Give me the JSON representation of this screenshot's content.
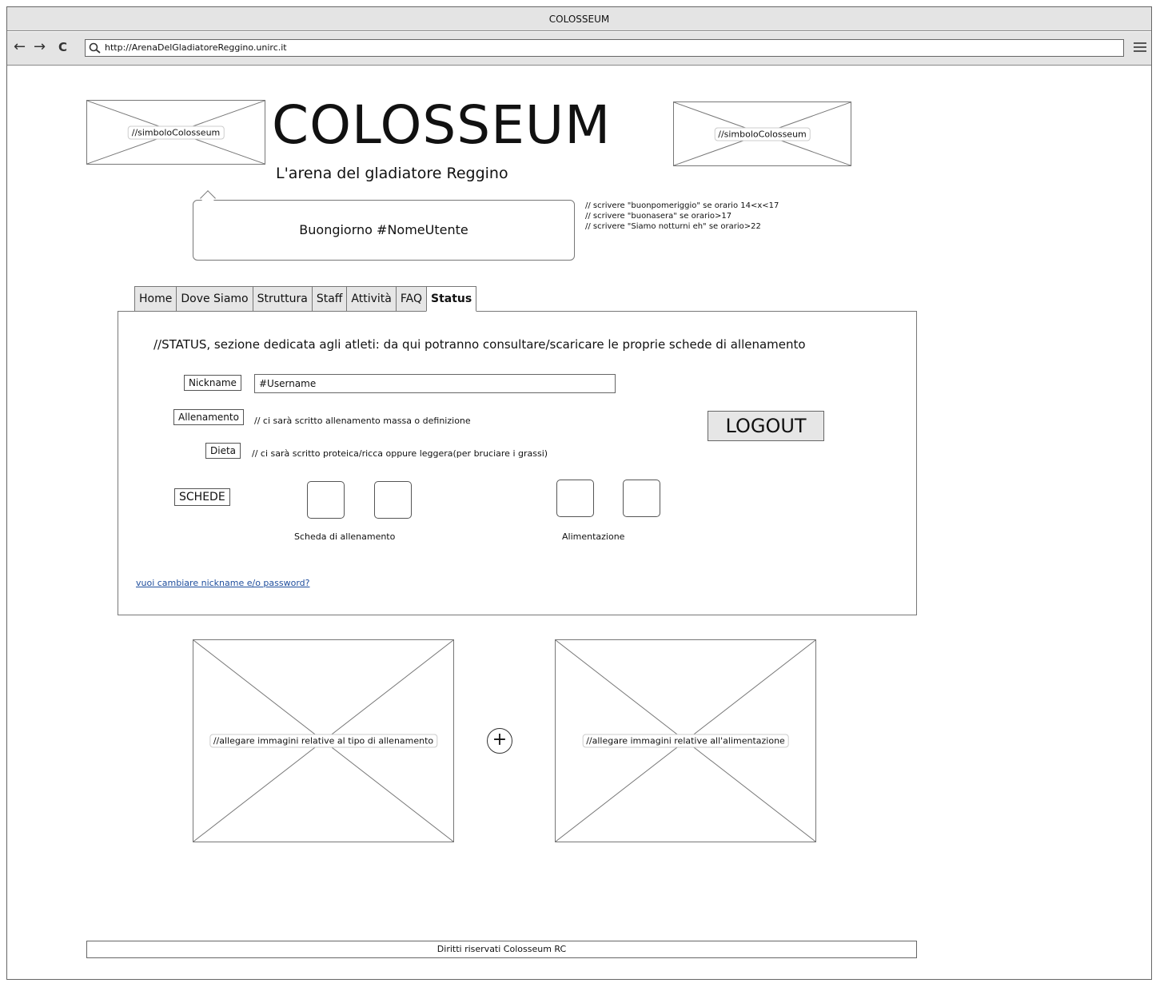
{
  "browser": {
    "window_title": "COLOSSEUM",
    "url": "http://ArenaDelGladiatoreReggino.unirc.it",
    "back_symbol": "←",
    "forward_symbol": "→",
    "reload_symbol": "C"
  },
  "header": {
    "logo_left_label": "//simboloColosseum",
    "logo_right_label": "//simboloColosseum",
    "title": "COLOSSEUM",
    "subtitle": "L'arena del gladiatore Reggino"
  },
  "greeting": {
    "text": "Buongiorno  #NomeUtente",
    "notes": [
      "// scrivere \"buonpomeriggio\" se orario  14<x<17",
      "//  scrivere \"buonasera\" se orario>17",
      "//   scrivere \"Siamo notturni eh\" se orario>22"
    ]
  },
  "tabs": [
    {
      "label": "Home"
    },
    {
      "label": "Dove Siamo"
    },
    {
      "label": "Struttura"
    },
    {
      "label": "Staff"
    },
    {
      "label": "Attività"
    },
    {
      "label": "FAQ"
    },
    {
      "label": "Status",
      "active": true
    }
  ],
  "status": {
    "heading": "//STATUS, sezione dedicata agli atleti: da qui potranno consultare/scaricare le proprie schede di allenamento",
    "nickname_label": "Nickname",
    "nickname_value": "#Username",
    "allenamento_label": "Allenamento",
    "allenamento_note": "// ci sarà scritto allenamento massa o definizione",
    "dieta_label": "Dieta",
    "dieta_note": "// ci sarà scritto proteica/ricca oppure leggera(per bruciare i grassi)",
    "schede_label": "SCHEDE",
    "logout_label": "LOGOUT",
    "scheda_group_label": "Scheda di allenamento",
    "alimentazione_group_label": "Alimentazione",
    "change_link": "vuoi cambiare nickname e/o password?"
  },
  "images": {
    "left_label": "//allegare immagini relative al tipo di allenamento",
    "right_label": "//allegare immagini relative all'alimentazione",
    "plus_symbol": "+"
  },
  "footer": {
    "text": "Diritti riservati Colosseum RC"
  }
}
